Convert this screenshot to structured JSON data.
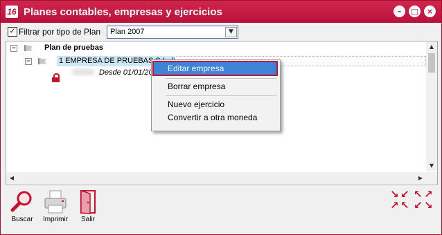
{
  "window": {
    "title": "Planes contables, empresas y ejercicios",
    "app_icon": "16"
  },
  "window_buttons": {
    "minimize": "–",
    "maximize": "□",
    "close": "×"
  },
  "filter": {
    "checked": true,
    "label": "Filtrar por tipo de Plan",
    "combo_value": "Plan 2007"
  },
  "tree": {
    "root_label": "Plan de pruebas",
    "company_label": "1 EMPRESA DE PRUEBAS S.L. (Eur)",
    "exercise_label": "Desde 01/01/20"
  },
  "context_menu": {
    "items": [
      {
        "label": "Editar empresa",
        "highlighted": true
      },
      {
        "label": "Borrar empresa"
      },
      {
        "label": "Nuevo ejercicio"
      },
      {
        "label": "Convertir a otra moneda"
      }
    ]
  },
  "toolbar": {
    "search_label": "Buscar",
    "print_label": "Imprimir",
    "exit_label": "Salir"
  },
  "icons": [
    "app-icon",
    "minimize-icon",
    "maximize-icon",
    "close-icon",
    "checkbox-icon",
    "dropdown-arrow-icon",
    "collapse-icon",
    "flag-icon",
    "lock-icon",
    "magnifier-icon",
    "printer-icon",
    "door-exit-icon",
    "collapse-arrows-icon",
    "expand-arrows-icon"
  ],
  "colors": {
    "accent": "#b9123a",
    "selection": "#cde6f7",
    "menu_highlight": "#3d83d8"
  }
}
